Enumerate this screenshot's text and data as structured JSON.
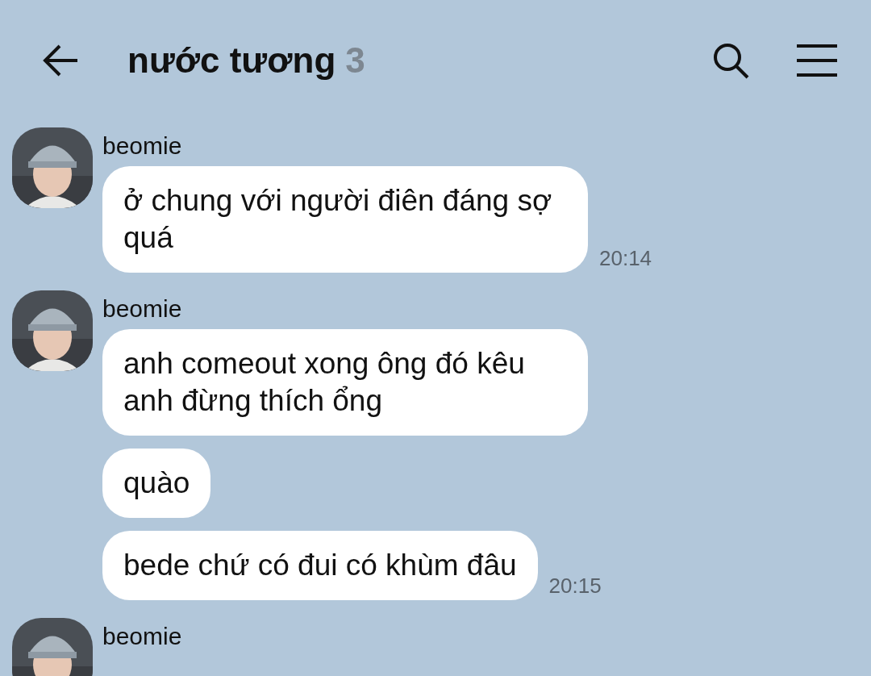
{
  "header": {
    "title": "nước tương",
    "member_count": "3"
  },
  "groups": [
    {
      "sender": "beomie",
      "messages": [
        {
          "text": "ở chung với người điên đáng sợ quá",
          "time": "20:14"
        }
      ]
    },
    {
      "sender": "beomie",
      "messages": [
        {
          "text": "anh comeout xong ông đó kêu anh đừng thích ổng"
        },
        {
          "text": "quào"
        },
        {
          "text": "bede chứ có đui có khùm đâu",
          "time": "20:15"
        }
      ]
    },
    {
      "sender": "beomie"
    }
  ]
}
